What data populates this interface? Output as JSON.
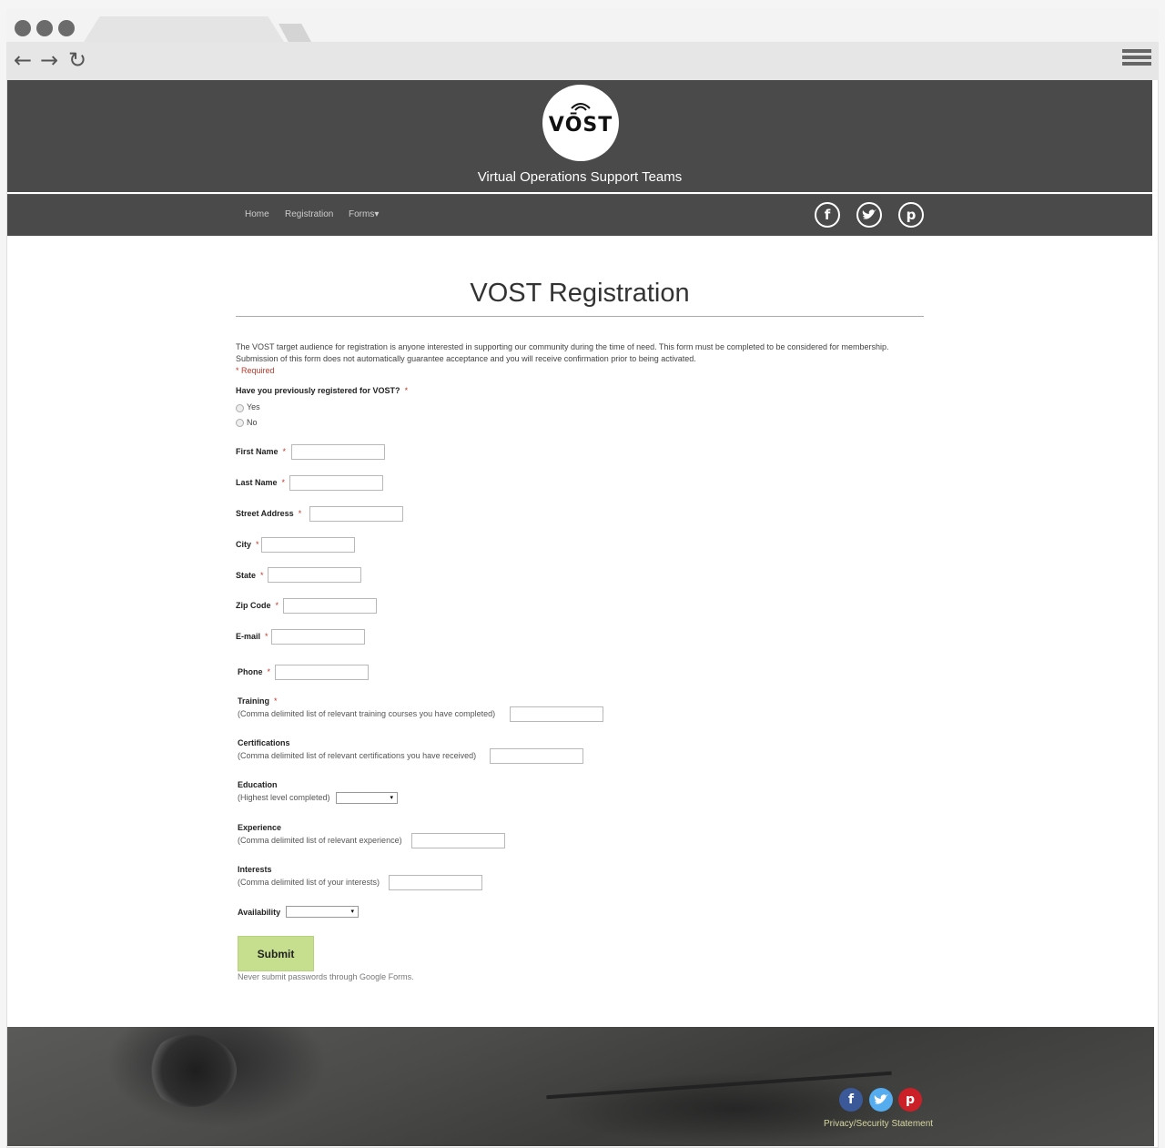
{
  "site": {
    "logo_text": "VŌST",
    "tagline": "Virtual Operations Support Teams"
  },
  "nav": {
    "items": [
      "Home",
      "Registration",
      "Forms"
    ],
    "forms_caret": "▾",
    "social_icons": [
      "facebook-icon",
      "twitter-icon",
      "pinterest-icon"
    ]
  },
  "page": {
    "title": "VOST Registration",
    "intro": "The VOST target audience for registration is anyone interested in supporting our community during the time of need. This form must be completed to be considered for membership. Submission of this form does not automatically guarantee acceptance and you will receive confirmation prior to being activated.",
    "required_note": "* Required"
  },
  "form": {
    "previously_registered": {
      "label": "Have you previously registered for VOST?",
      "options": [
        "Yes",
        "No"
      ]
    },
    "required_mark": "*",
    "first_name": {
      "label": "First Name",
      "value": ""
    },
    "last_name": {
      "label": "Last Name",
      "value": ""
    },
    "street_address": {
      "label": "Street Address",
      "value": ""
    },
    "city": {
      "label": "City",
      "value": ""
    },
    "state": {
      "label": "State",
      "value": ""
    },
    "zip_code": {
      "label": "Zip Code",
      "value": ""
    },
    "email": {
      "label": "E-mail",
      "value": ""
    },
    "phone": {
      "label": "Phone",
      "value": ""
    },
    "training": {
      "label": "Training",
      "help": "(Comma delimited list of relevant training courses you have completed)",
      "value": ""
    },
    "certifications": {
      "label": "Certifications",
      "help": "(Comma delimited list of relevant certifications you have received)",
      "value": ""
    },
    "education": {
      "label": "Education",
      "help": "(Highest level completed)",
      "selected": "▾"
    },
    "experience": {
      "label": "Experience",
      "help": "(Comma delimited list of relevant experience)",
      "value": ""
    },
    "interests": {
      "label": "Interests",
      "help": "(Comma delimited list of your interests)",
      "value": ""
    },
    "availability": {
      "label": "Availability",
      "selected": "▾"
    },
    "submit_label": "Submit",
    "footer_note": "Never submit passwords through Google Forms."
  },
  "footer": {
    "privacy_link": "Privacy/Security Statement",
    "social_icons": [
      "facebook-icon",
      "twitter-icon",
      "pinterest-icon"
    ],
    "colors": {
      "facebook": "#3b5998",
      "twitter": "#55acee",
      "pinterest": "#cb2027"
    }
  },
  "browser": {
    "back_icon": "←",
    "forward_icon": "→",
    "reload_icon": "↻"
  },
  "colors": {
    "header_bg": "#4a4a4a",
    "submit_bg": "#c5df8e",
    "required": "#c0392b"
  }
}
